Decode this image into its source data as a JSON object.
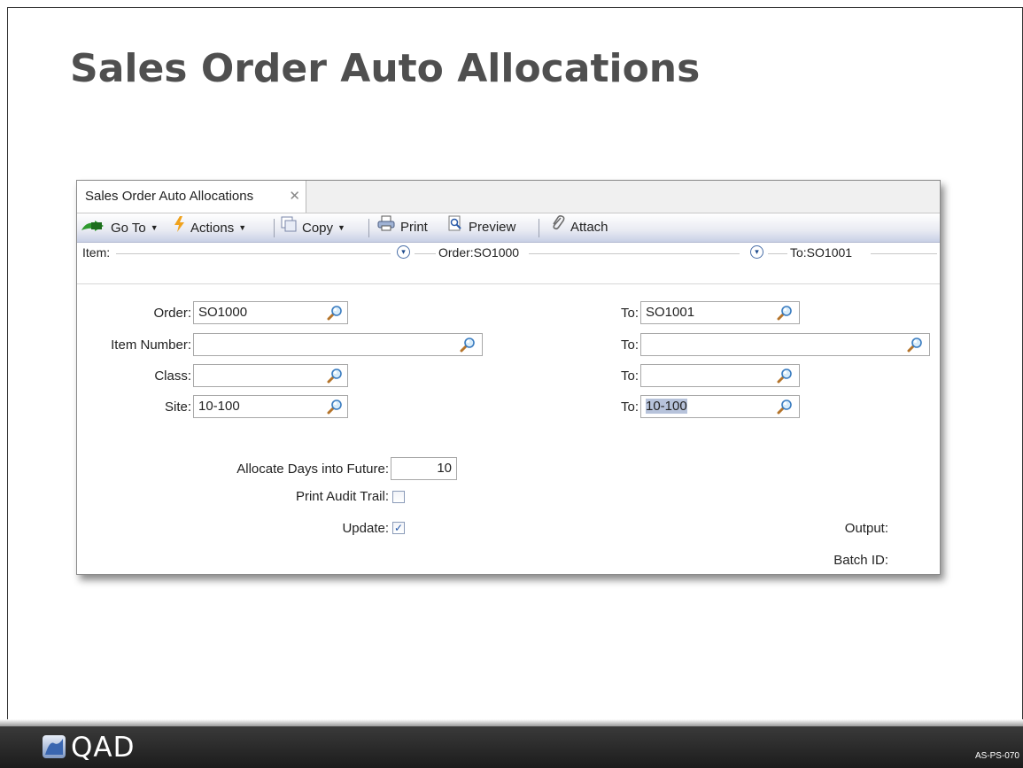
{
  "slide": {
    "title": "Sales Order Auto Allocations",
    "code": "AS-PS-070"
  },
  "window": {
    "tab_label": "Sales Order Auto Allocations",
    "tab_close": "✕",
    "toolbar": {
      "goto": "Go To",
      "actions": "Actions",
      "copy": "Copy",
      "print": "Print",
      "preview": "Preview",
      "attach": "Attach"
    },
    "header": {
      "item": "Item:",
      "order": "Order:SO1000",
      "to": "To:SO1001"
    },
    "form": {
      "order_label": "Order:",
      "order_value": "SO1000",
      "order_to_label": "To:",
      "order_to_value": "SO1001",
      "item_label": "Item Number:",
      "item_value": "",
      "item_to_label": "To:",
      "item_to_value": "",
      "class_label": "Class:",
      "class_value": "",
      "class_to_label": "To:",
      "class_to_value": "",
      "site_label": "Site:",
      "site_value": "10-100",
      "site_to_label": "To:",
      "site_to_value": "10-100",
      "days_label": "Allocate Days into Future:",
      "days_value": "10",
      "audit_label": "Print Audit Trail:",
      "audit_checked": false,
      "update_label": "Update:",
      "update_checked": true,
      "output_label": "Output:",
      "batch_label": "Batch ID:"
    }
  },
  "footer": {
    "logo_text": "QAD"
  },
  "colors": {
    "title": "#4f4f4f",
    "footer": "#2a2a2a",
    "toolbar_accent": "#c8d0e6",
    "selection": "#b7c3db"
  }
}
